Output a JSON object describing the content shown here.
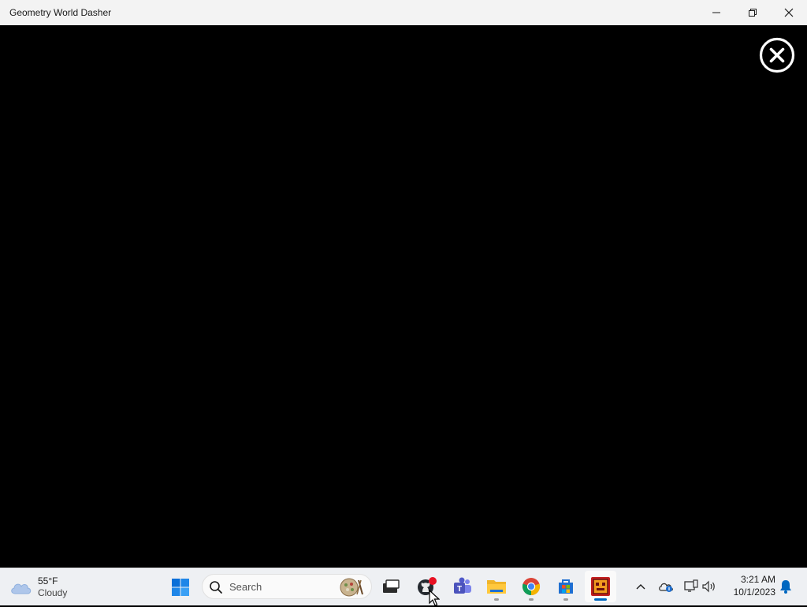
{
  "window": {
    "title": "Geometry World Dasher"
  },
  "taskbar": {
    "weather": {
      "temp": "55°F",
      "condition": "Cloudy"
    },
    "search": {
      "placeholder": "Search"
    },
    "clock": {
      "time": "3:21 AM",
      "date": "10/1/2023"
    }
  },
  "icons": {
    "window_minimize": "minimize-icon",
    "window_maximize": "restore-icon",
    "window_close": "close-icon",
    "game_close": "circle-close-icon"
  },
  "colors": {
    "accent": "#0067c0",
    "notification_badge": "#e81123"
  }
}
